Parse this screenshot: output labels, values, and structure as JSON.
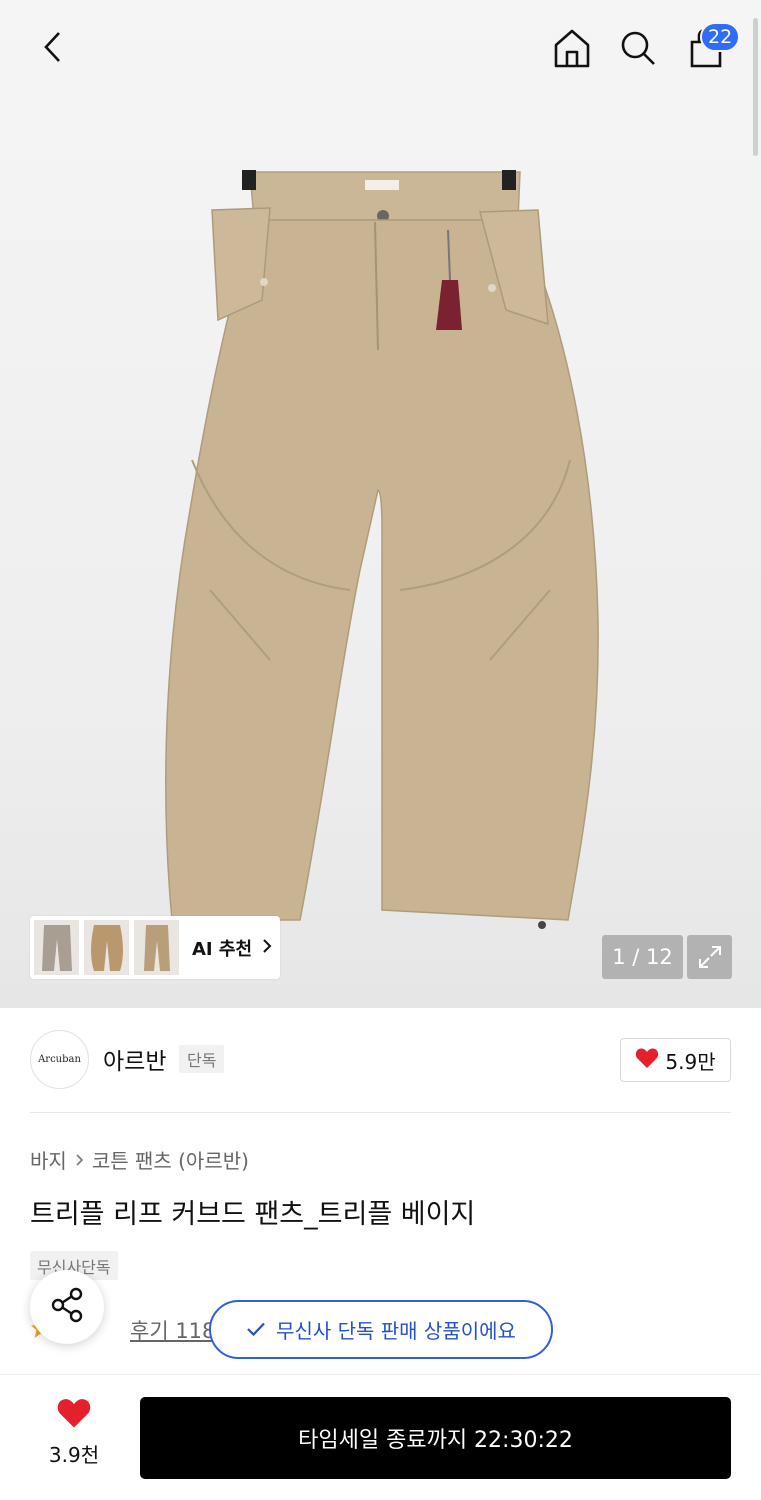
{
  "header": {
    "cart_count": "22",
    "icons": [
      "back-icon",
      "home-icon",
      "search-icon",
      "bag-icon"
    ]
  },
  "gallery": {
    "ai_recommend_label": "AI 추천",
    "page_indicator": "1 / 12",
    "product_image_icon": "wide-curved-pants-illustration"
  },
  "brand": {
    "logo_text": "Arcuban",
    "name": "아르반",
    "exclusive_label": "단독",
    "like_count": "5.9만"
  },
  "breadcrumb": {
    "items": [
      "바지",
      "코튼 팬츠 (아르반)"
    ]
  },
  "product": {
    "title": "트리플 리프 커브드 팬츠_트리플 베이지",
    "tag": "무신사단독",
    "review_label": "후기 118개"
  },
  "toast": {
    "message": "무신사 단독 판매 상품이에요"
  },
  "bottom": {
    "like_count": "3.9천",
    "buy_label": "타임세일 종료까지 22:30:22"
  },
  "colors": {
    "accent_blue": "#2f6df6",
    "heart_red": "#e3202b",
    "toast_border": "#2f5fe0"
  }
}
